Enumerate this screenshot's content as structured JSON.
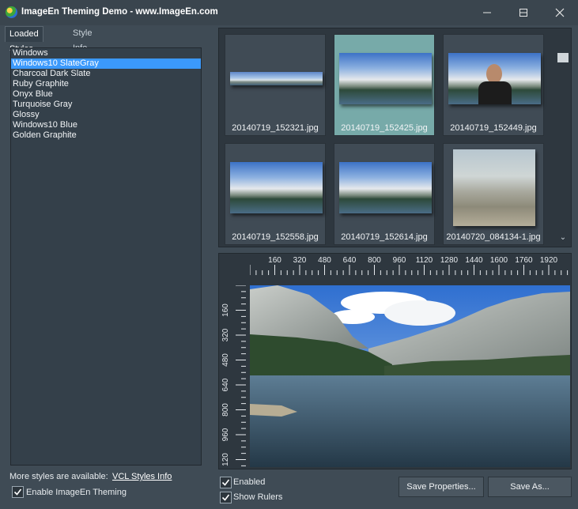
{
  "window": {
    "title": "ImageEn Theming Demo - www.ImageEn.com"
  },
  "tabs": [
    {
      "label": "Loaded Styles"
    },
    {
      "label": "Style Info"
    }
  ],
  "styles": {
    "items": [
      "Windows",
      "Windows10 SlateGray",
      "Charcoal Dark Slate",
      "Ruby Graphite",
      "Onyx Blue",
      "Turquoise Gray",
      "Glossy",
      "Windows10 Blue",
      "Golden Graphite"
    ],
    "selected": "Windows10 SlateGray"
  },
  "footer": {
    "more_label": "More styles are available:",
    "link_label": "VCL Styles Info",
    "enable_theming_label": "Enable ImageEn Theming",
    "enable_theming_checked": true
  },
  "thumbnails": [
    {
      "caption": "20140719_152321.jpg",
      "selected": false
    },
    {
      "caption": "20140719_152425.jpg",
      "selected": true
    },
    {
      "caption": "20140719_152449.jpg",
      "selected": false
    },
    {
      "caption": "20140719_152558.jpg",
      "selected": false
    },
    {
      "caption": "20140719_152614.jpg",
      "selected": false
    },
    {
      "caption": "20140720_084134-1.jpg",
      "selected": false
    }
  ],
  "ruler": {
    "horizontal_labels": [
      "160",
      "320",
      "480",
      "640",
      "800",
      "960",
      "1120",
      "1280",
      "1440",
      "1600",
      "1760",
      "1920",
      "2"
    ],
    "vertical_labels": [
      "160",
      "320",
      "480",
      "640",
      "800",
      "960",
      "120"
    ]
  },
  "options": {
    "enabled_label": "Enabled",
    "enabled_checked": true,
    "show_rulers_label": "Show Rulers",
    "show_rulers_checked": true
  },
  "buttons": {
    "save_properties": "Save Properties...",
    "save_as": "Save As..."
  },
  "colors": {
    "selection": "#3b99fc",
    "selected_thumb": "#77aaa9",
    "window_bg": "#3f4b55"
  }
}
